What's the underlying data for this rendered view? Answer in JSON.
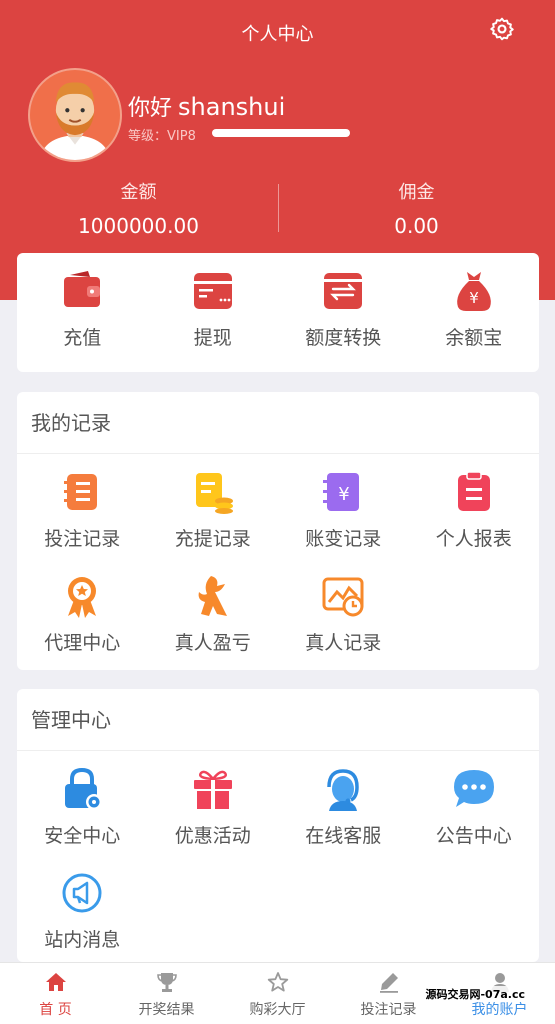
{
  "header": {
    "title": "个人中心",
    "greeting": "你好",
    "username": "shanshui",
    "vip_label": "等级：VIP8",
    "balance_label": "金额",
    "balance_value": "1000000.00",
    "commission_label": "佣金",
    "commission_value": "0.00"
  },
  "quick_actions": [
    {
      "label": "充值",
      "icon": "wallet-icon"
    },
    {
      "label": "提现",
      "icon": "card-icon"
    },
    {
      "label": "额度转换",
      "icon": "transfer-icon"
    },
    {
      "label": "余额宝",
      "icon": "money-bag-icon"
    }
  ],
  "records": {
    "title": "我的记录",
    "items": [
      {
        "label": "投注记录",
        "icon": "bet-record-icon"
      },
      {
        "label": "充提记录",
        "icon": "deposit-record-icon"
      },
      {
        "label": "账变记录",
        "icon": "account-change-icon"
      },
      {
        "label": "个人报表",
        "icon": "report-icon"
      },
      {
        "label": "代理中心",
        "icon": "agent-medal-icon"
      },
      {
        "label": "真人盈亏",
        "icon": "live-profit-icon"
      },
      {
        "label": "真人记录",
        "icon": "live-record-icon"
      }
    ]
  },
  "management": {
    "title": "管理中心",
    "items": [
      {
        "label": "安全中心",
        "icon": "security-lock-icon"
      },
      {
        "label": "优惠活动",
        "icon": "gift-icon"
      },
      {
        "label": "在线客服",
        "icon": "customer-service-icon"
      },
      {
        "label": "公告中心",
        "icon": "chat-bubble-icon"
      },
      {
        "label": "站内消息",
        "icon": "megaphone-icon"
      }
    ]
  },
  "tabbar": [
    {
      "label": "首 页",
      "icon": "home-icon",
      "active": true
    },
    {
      "label": "开奖结果",
      "icon": "trophy-icon",
      "active": false
    },
    {
      "label": "购彩大厅",
      "icon": "star-icon",
      "active": false
    },
    {
      "label": "投注记录",
      "icon": "pen-icon",
      "active": false
    },
    {
      "label": "我的账户",
      "icon": "user-icon",
      "active": false
    }
  ],
  "watermark": "源码交易网-07a.cc",
  "colors": {
    "brand": "#dc4441",
    "active_tab": "#dc4441",
    "tab_inactive_text": "#666666",
    "my_account_tab_text": "#3b8fe6"
  }
}
